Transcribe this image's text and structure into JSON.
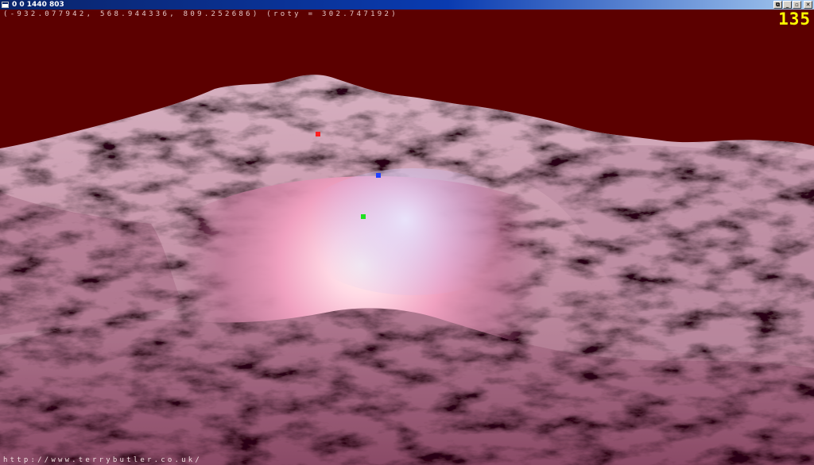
{
  "window": {
    "title": "0 0 1440 803",
    "buttons": {
      "restore_label": "⧉",
      "minimize_label": "_",
      "maximize_label": "▫",
      "close_label": "✕"
    }
  },
  "hud": {
    "coordinates": "(-932.077942, 568.944336, 809.252686) (roty = 302.747192)",
    "fps": "135",
    "url": "http://www.terrybutler.co.uk/"
  },
  "scene": {
    "background_color": "#5c0000",
    "markers": [
      {
        "name": "red-marker",
        "color": "#ff2020"
      },
      {
        "name": "blue-marker",
        "color": "#2040ff"
      },
      {
        "name": "green-marker",
        "color": "#20e020"
      }
    ]
  }
}
